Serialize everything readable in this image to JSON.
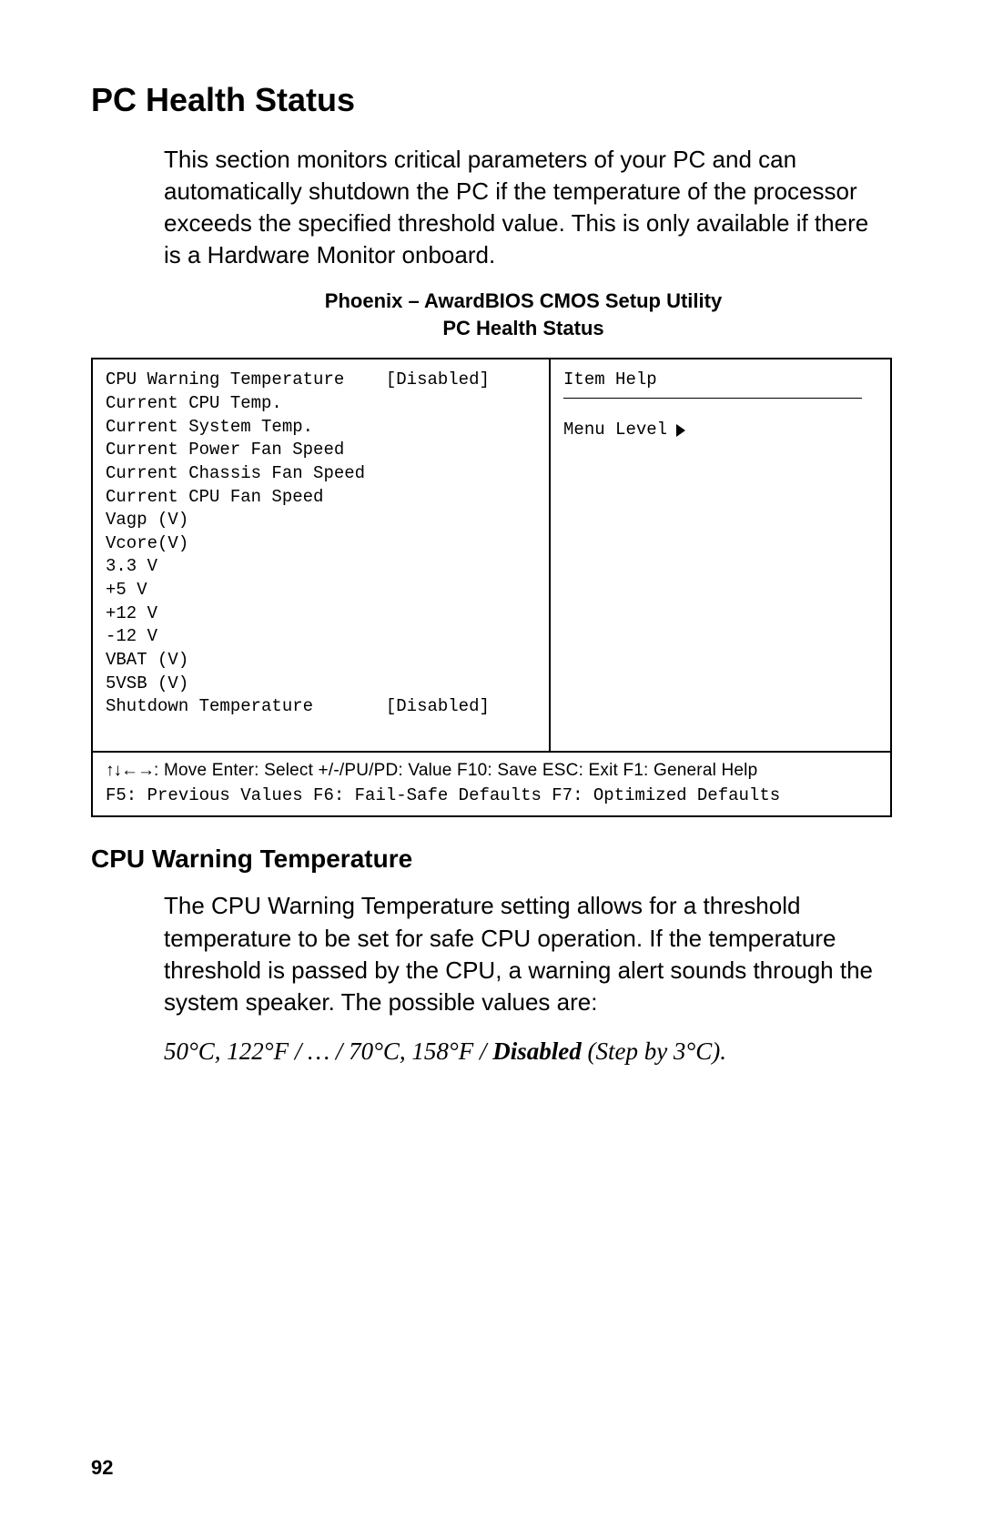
{
  "headings": {
    "h1": "PC Health Status",
    "h2": "CPU Warning Temperature"
  },
  "paragraphs": {
    "intro": "This section monitors critical parameters of your PC and can automatically shutdown the PC if the temperature of the processor exceeds the specified threshold value. This is only available if there is a Hardware Monitor onboard.",
    "cpu_warning": "The CPU Warning Temperature setting allows for a threshold temperature to be set for safe CPU operation. If the temperature threshold is passed by the CPU, a warning alert sounds through the system speaker. The possible values are:"
  },
  "bios_header": {
    "line1": "Phoenix – AwardBIOS CMOS Setup Utility",
    "line2": "PC Health Status"
  },
  "bios": {
    "items": [
      {
        "label": "CPU Warning Temperature    ",
        "value": "[Disabled]"
      },
      {
        "label": "Current CPU Temp.",
        "value": ""
      },
      {
        "label": "Current System Temp.",
        "value": ""
      },
      {
        "label": "Current Power Fan Speed",
        "value": ""
      },
      {
        "label": "Current Chassis Fan Speed",
        "value": ""
      },
      {
        "label": "Current CPU Fan Speed",
        "value": ""
      },
      {
        "label": "Vagp (V)",
        "value": ""
      },
      {
        "label": "Vcore(V)",
        "value": ""
      },
      {
        "label": "3.3 V",
        "value": ""
      },
      {
        "label": "+5 V",
        "value": ""
      },
      {
        "label": "+12 V",
        "value": ""
      },
      {
        "label": "-12 V",
        "value": ""
      },
      {
        "label": "VBAT (V)",
        "value": ""
      },
      {
        "label": "5VSB (V)",
        "value": ""
      },
      {
        "label": "Shutdown Temperature       ",
        "value": "[Disabled]"
      }
    ],
    "help_title": "Item Help",
    "menu_level": "Menu Level",
    "footer": {
      "line1_arrows": "↑↓←→",
      "line1_rest": ": Move  Enter: Select  +/-/PU/PD: Value  F10: Save  ESC: Exit  F1: General Help",
      "line2": "F5: Previous Values   F6: Fail-Safe Defaults   F7: Optimized Defaults"
    }
  },
  "values_line": {
    "text_before": "50°C, 122°F / … / 70°C, 158°F / ",
    "bold": "Disabled",
    "text_after": "  (Step by 3°C)."
  },
  "page_number": "92"
}
